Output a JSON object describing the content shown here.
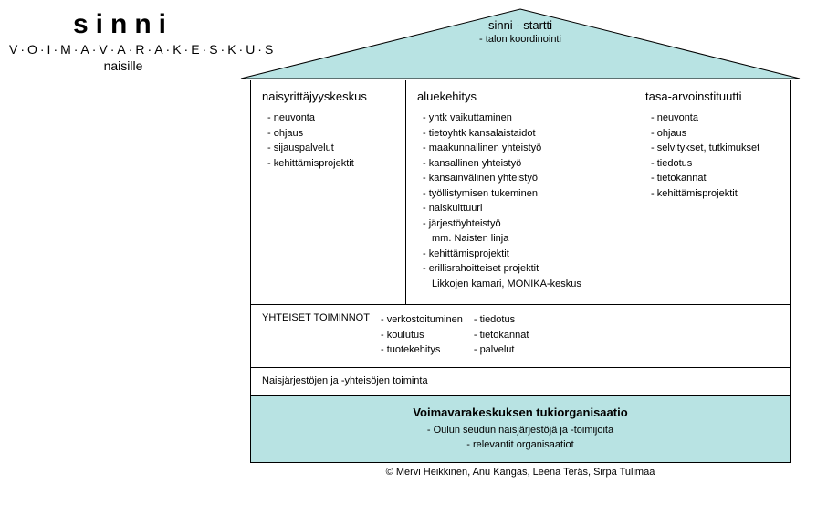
{
  "logo": {
    "title": "sinni",
    "subtitle": "V·O·I·M·A·V·A·R·A·K·E·S·K·U·S",
    "subtitle2": "naisille"
  },
  "roof": {
    "title": "sinni - startti",
    "item": "- talon koordinointi"
  },
  "columns": [
    {
      "title": "naisyrittäjyyskeskus",
      "items": [
        "- neuvonta",
        "- ohjaus",
        "- sijauspalvelut",
        "- kehittämisprojektit"
      ]
    },
    {
      "title": "aluekehitys",
      "items": [
        "- yhtk vaikuttaminen",
        "- tietoyhtk kansalaistaidot",
        "- maakunnallinen yhteistyö",
        "- kansallinen yhteistyö",
        "- kansainvälinen yhteistyö",
        "- työllistymisen tukeminen",
        "- naiskulttuuri",
        "- järjestöyhteistyö",
        "  mm. Naisten linja",
        "- kehittämisprojektit",
        "- erillisrahoitteiset projektit",
        "  Likkojen kamari, MONIKA-keskus"
      ]
    },
    {
      "title": "tasa-arvoinstituutti",
      "items": [
        "- neuvonta",
        "- ohjaus",
        "- selvitykset, tutkimukset",
        "- tiedotus",
        "- tietokannat",
        "- kehittämisprojektit"
      ]
    }
  ],
  "shared": {
    "label": "YHTEISET TOIMINNOT",
    "colA": [
      "- verkostoituminen",
      "- koulutus",
      "- tuotekehitys"
    ],
    "colB": [
      "- tiedotus",
      "- tietokannat",
      "- palvelut"
    ]
  },
  "orgRow": "Naisjärjestöjen ja -yhteisöjen toiminta",
  "foundation": {
    "title": "Voimavarakeskuksen tukiorganisaatio",
    "items": [
      "- Oulun seudun naisjärjestöjä ja -toimijoita",
      "- relevantit organisaatiot"
    ]
  },
  "copyright": "© Mervi Heikkinen, Anu Kangas, Leena Teräs, Sirpa Tulimaa"
}
